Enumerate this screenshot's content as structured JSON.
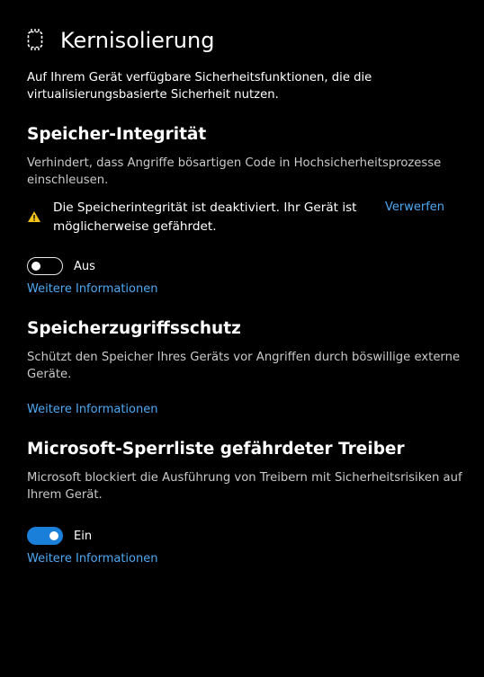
{
  "header": {
    "title": "Kernisolierung",
    "icon": "core-isolation-chip-icon"
  },
  "intro": "Auf Ihrem Gerät verfügbare Sicherheitsfunktionen, die die virtualisierungsbasierte Sicherheit nutzen.",
  "memory_integrity": {
    "heading": "Speicher-Integrität",
    "description": "Verhindert, dass Angriffe bösartigen Code in Hochsicherheitsprozesse einschleusen.",
    "warning": {
      "icon": "warning-icon",
      "color": "#f2c318",
      "text": "Die Speicherintegrität ist deaktiviert. Ihr Gerät ist möglicherweise gefährdet.",
      "dismiss_label": "Verwerfen"
    },
    "toggle": {
      "state": "off",
      "label": "Aus"
    },
    "more_info": "Weitere Informationen"
  },
  "memory_access_protection": {
    "heading": "Speicherzugriffsschutz",
    "description": "Schützt den Speicher Ihres Geräts vor Angriffen durch böswillige externe Geräte.",
    "more_info": "Weitere Informationen"
  },
  "driver_blocklist": {
    "heading": "Microsoft-Sperrliste gefährdeter Treiber",
    "description": "Microsoft blockiert die Ausführung von Treibern mit Sicherheitsrisiken auf Ihrem Gerät.",
    "toggle": {
      "state": "on",
      "label": "Ein"
    },
    "more_info": "Weitere Informationen"
  },
  "colors": {
    "background": "#000000",
    "link": "#4ea8f2",
    "toggle_on": "#1a7fd8",
    "text_secondary": "#c9c9c9"
  }
}
